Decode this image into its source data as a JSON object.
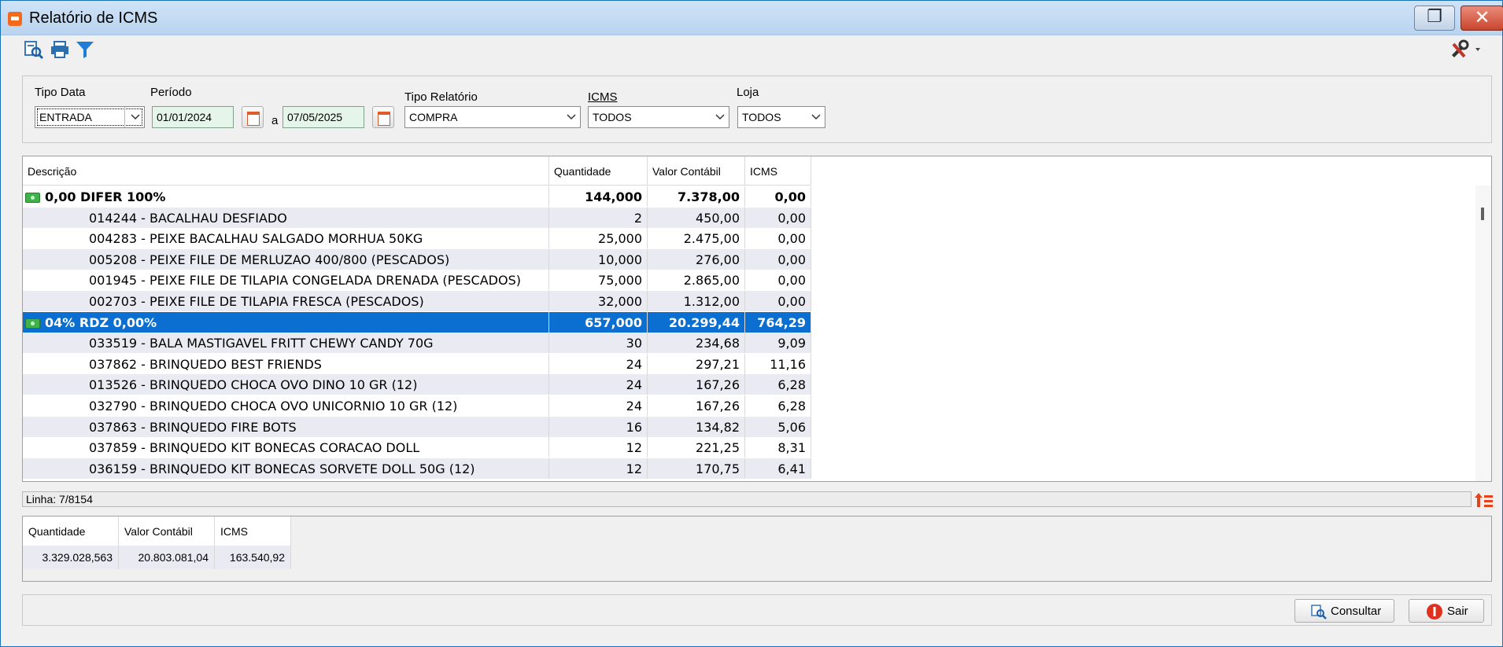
{
  "window": {
    "title": "Relatório de ICMS"
  },
  "filters": {
    "tipo_data_label": "Tipo Data",
    "tipo_data_value": "ENTRADA",
    "periodo_label": "Período",
    "date_start": "01/01/2024",
    "date_sep": "a",
    "date_end": "07/05/2025",
    "tipo_relatorio_label": "Tipo Relatório",
    "tipo_relatorio_value": "COMPRA",
    "icms_label": "ICMS",
    "icms_value": "TODOS",
    "loja_label": "Loja",
    "loja_value": "TODOS"
  },
  "grid": {
    "columns": [
      "Descrição",
      "Quantidade",
      "Valor Contábil",
      "ICMS"
    ],
    "rows": [
      {
        "type": "group",
        "desc": "0,00 DIFER 100%",
        "qtd": "144,000",
        "val": "7.378,00",
        "icms": "0,00"
      },
      {
        "type": "item",
        "desc": "014244 - BACALHAU DESFIADO",
        "qtd": "2",
        "val": "450,00",
        "icms": "0,00"
      },
      {
        "type": "item",
        "desc": "004283 - PEIXE BACALHAU SALGADO MORHUA 50KG",
        "qtd": "25,000",
        "val": "2.475,00",
        "icms": "0,00"
      },
      {
        "type": "item",
        "desc": "005208 - PEIXE FILE DE MERLUZAO 400/800 (PESCADOS)",
        "qtd": "10,000",
        "val": "276,00",
        "icms": "0,00"
      },
      {
        "type": "item",
        "desc": "001945 - PEIXE FILE DE TILAPIA CONGELADA DRENADA (PESCADOS)",
        "qtd": "75,000",
        "val": "2.865,00",
        "icms": "0,00"
      },
      {
        "type": "item",
        "desc": "002703 - PEIXE FILE DE TILAPIA FRESCA (PESCADOS)",
        "qtd": "32,000",
        "val": "1.312,00",
        "icms": "0,00"
      },
      {
        "type": "group-selected",
        "desc": "04% RDZ 0,00%",
        "qtd": "657,000",
        "val": "20.299,44",
        "icms": "764,29"
      },
      {
        "type": "item",
        "desc": "033519 - BALA MASTIGAVEL FRITT CHEWY CANDY 70G",
        "qtd": "30",
        "val": "234,68",
        "icms": "9,09"
      },
      {
        "type": "item",
        "desc": "037862 - BRINQUEDO BEST FRIENDS",
        "qtd": "24",
        "val": "297,21",
        "icms": "11,16"
      },
      {
        "type": "item",
        "desc": "013526 - BRINQUEDO CHOCA OVO DINO 10 GR (12)",
        "qtd": "24",
        "val": "167,26",
        "icms": "6,28"
      },
      {
        "type": "item",
        "desc": "032790 - BRINQUEDO CHOCA OVO UNICORNIO 10 GR (12)",
        "qtd": "24",
        "val": "167,26",
        "icms": "6,28"
      },
      {
        "type": "item",
        "desc": "037863 - BRINQUEDO FIRE BOTS",
        "qtd": "16",
        "val": "134,82",
        "icms": "5,06"
      },
      {
        "type": "item",
        "desc": "037859 - BRINQUEDO KIT BONECAS CORACAO DOLL",
        "qtd": "12",
        "val": "221,25",
        "icms": "8,31"
      },
      {
        "type": "item",
        "desc": "036159 - BRINQUEDO KIT BONECAS SORVETE DOLL 50G (12)",
        "qtd": "12",
        "val": "170,75",
        "icms": "6,41"
      }
    ]
  },
  "status": {
    "linha": "Linha: 7/8154"
  },
  "totals": {
    "headers": [
      "Quantidade",
      "Valor Contábil",
      "ICMS"
    ],
    "values": [
      "3.329.028,563",
      "20.803.081,04",
      "163.540,92"
    ]
  },
  "buttons": {
    "consultar": "Consultar",
    "sair": "Sair"
  },
  "icons": [
    "app-icon",
    "restore-icon",
    "close-icon",
    "search-preview-icon",
    "print-icon",
    "filter-icon",
    "tools-icon",
    "calendar-icon",
    "money-icon",
    "sort-icon",
    "exit-icon"
  ],
  "colors": {
    "selected_row": "#0a6fd1",
    "alt_row": "#eaeaf2",
    "date_field": "#e6f5ea",
    "close_button": "#c9452d"
  }
}
